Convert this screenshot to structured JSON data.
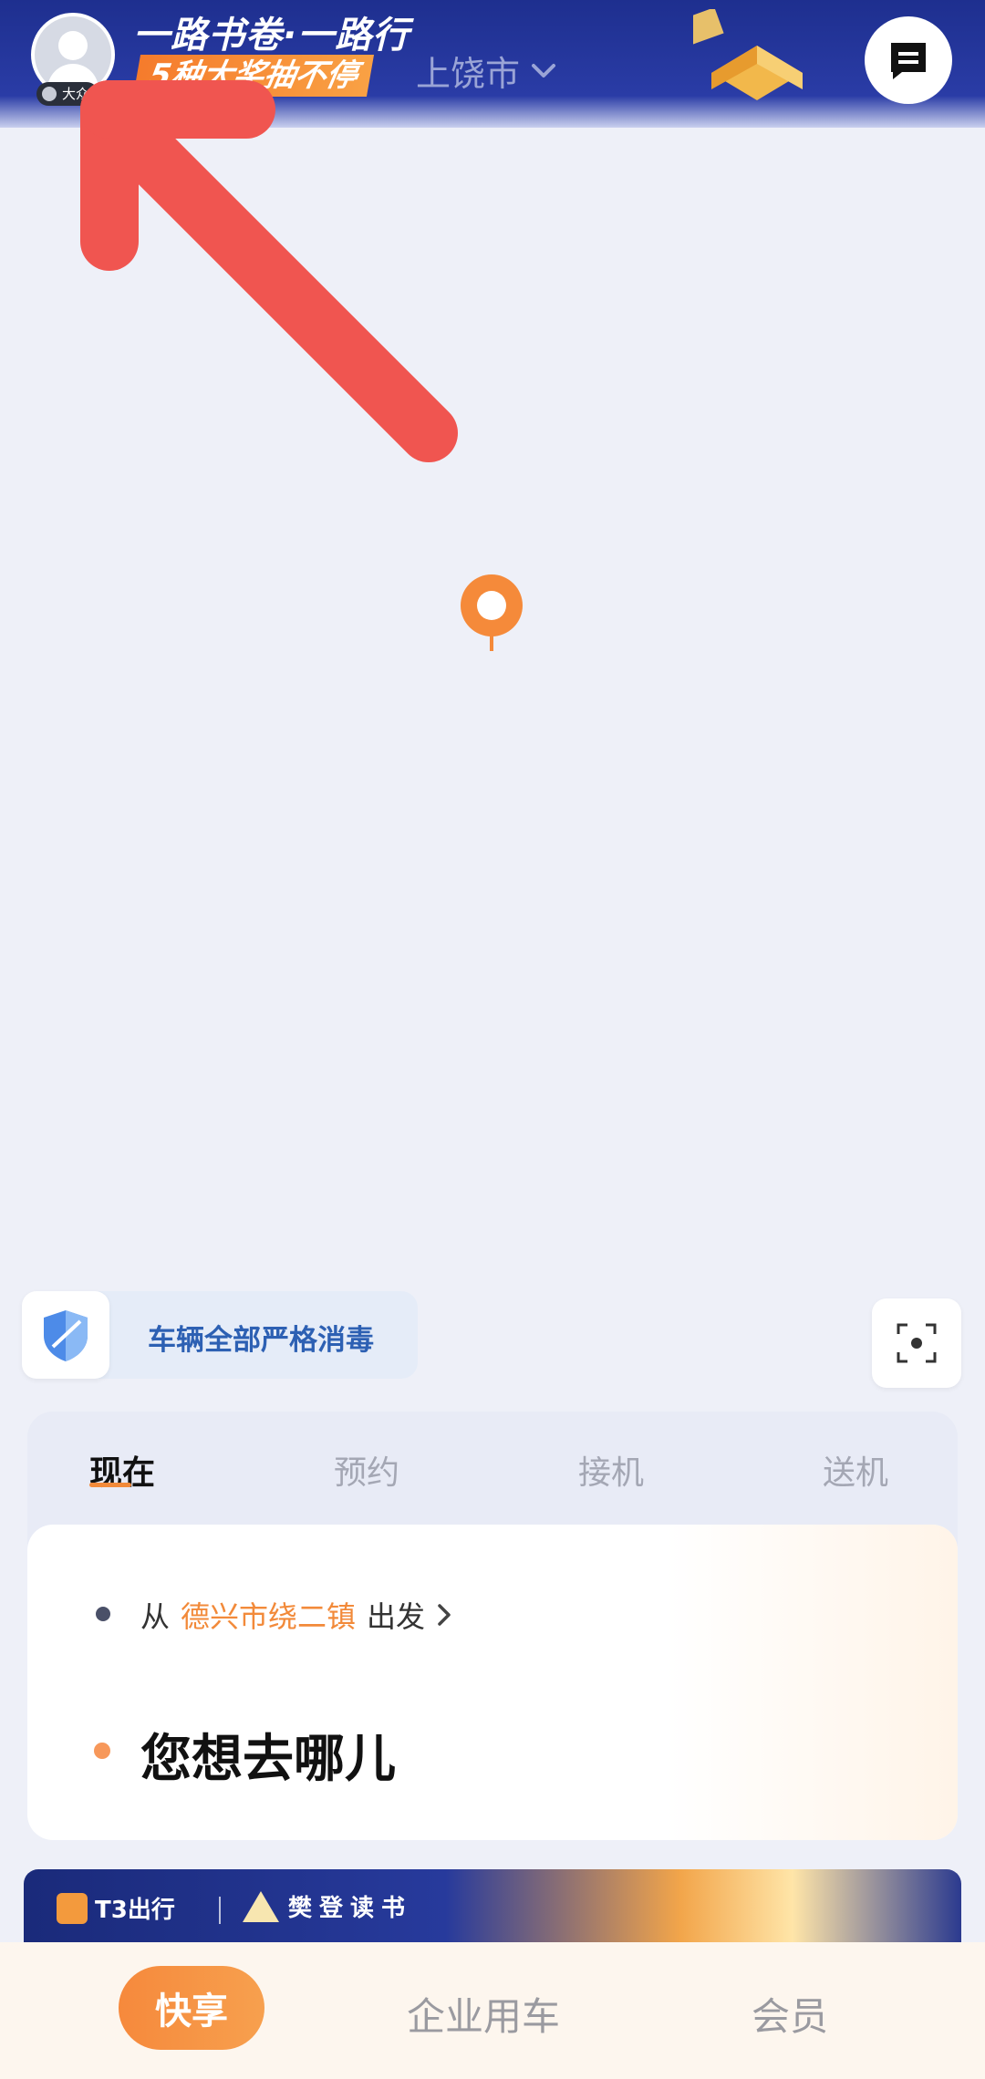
{
  "header": {
    "slogan": "一路书卷·一路行",
    "prize_tag": "5种大奖抽不停",
    "member_level": "大众",
    "city": "上饶市"
  },
  "safety_notice": {
    "text": "车辆全部严格消毒"
  },
  "ride_tabs": [
    {
      "label": "现在",
      "active": true
    },
    {
      "label": "预约",
      "active": false
    },
    {
      "label": "接机",
      "active": false
    },
    {
      "label": "送机",
      "active": false
    }
  ],
  "trip": {
    "from_prefix": "从",
    "from_place": "德兴市绕二镇",
    "from_suffix": "出发",
    "destination_placeholder": "您想去哪儿"
  },
  "banner": {
    "brand": "T3出行",
    "partner": "樊登读书"
  },
  "bottom_nav": [
    {
      "label": "快享",
      "active": true
    },
    {
      "label": "企业用车",
      "active": false
    },
    {
      "label": "会员",
      "active": false
    }
  ],
  "colors": {
    "accent": "#f28a3a",
    "header_bg": "#24379e",
    "notice_text": "#2d60b3",
    "annotation_arrow": "#f05550"
  }
}
